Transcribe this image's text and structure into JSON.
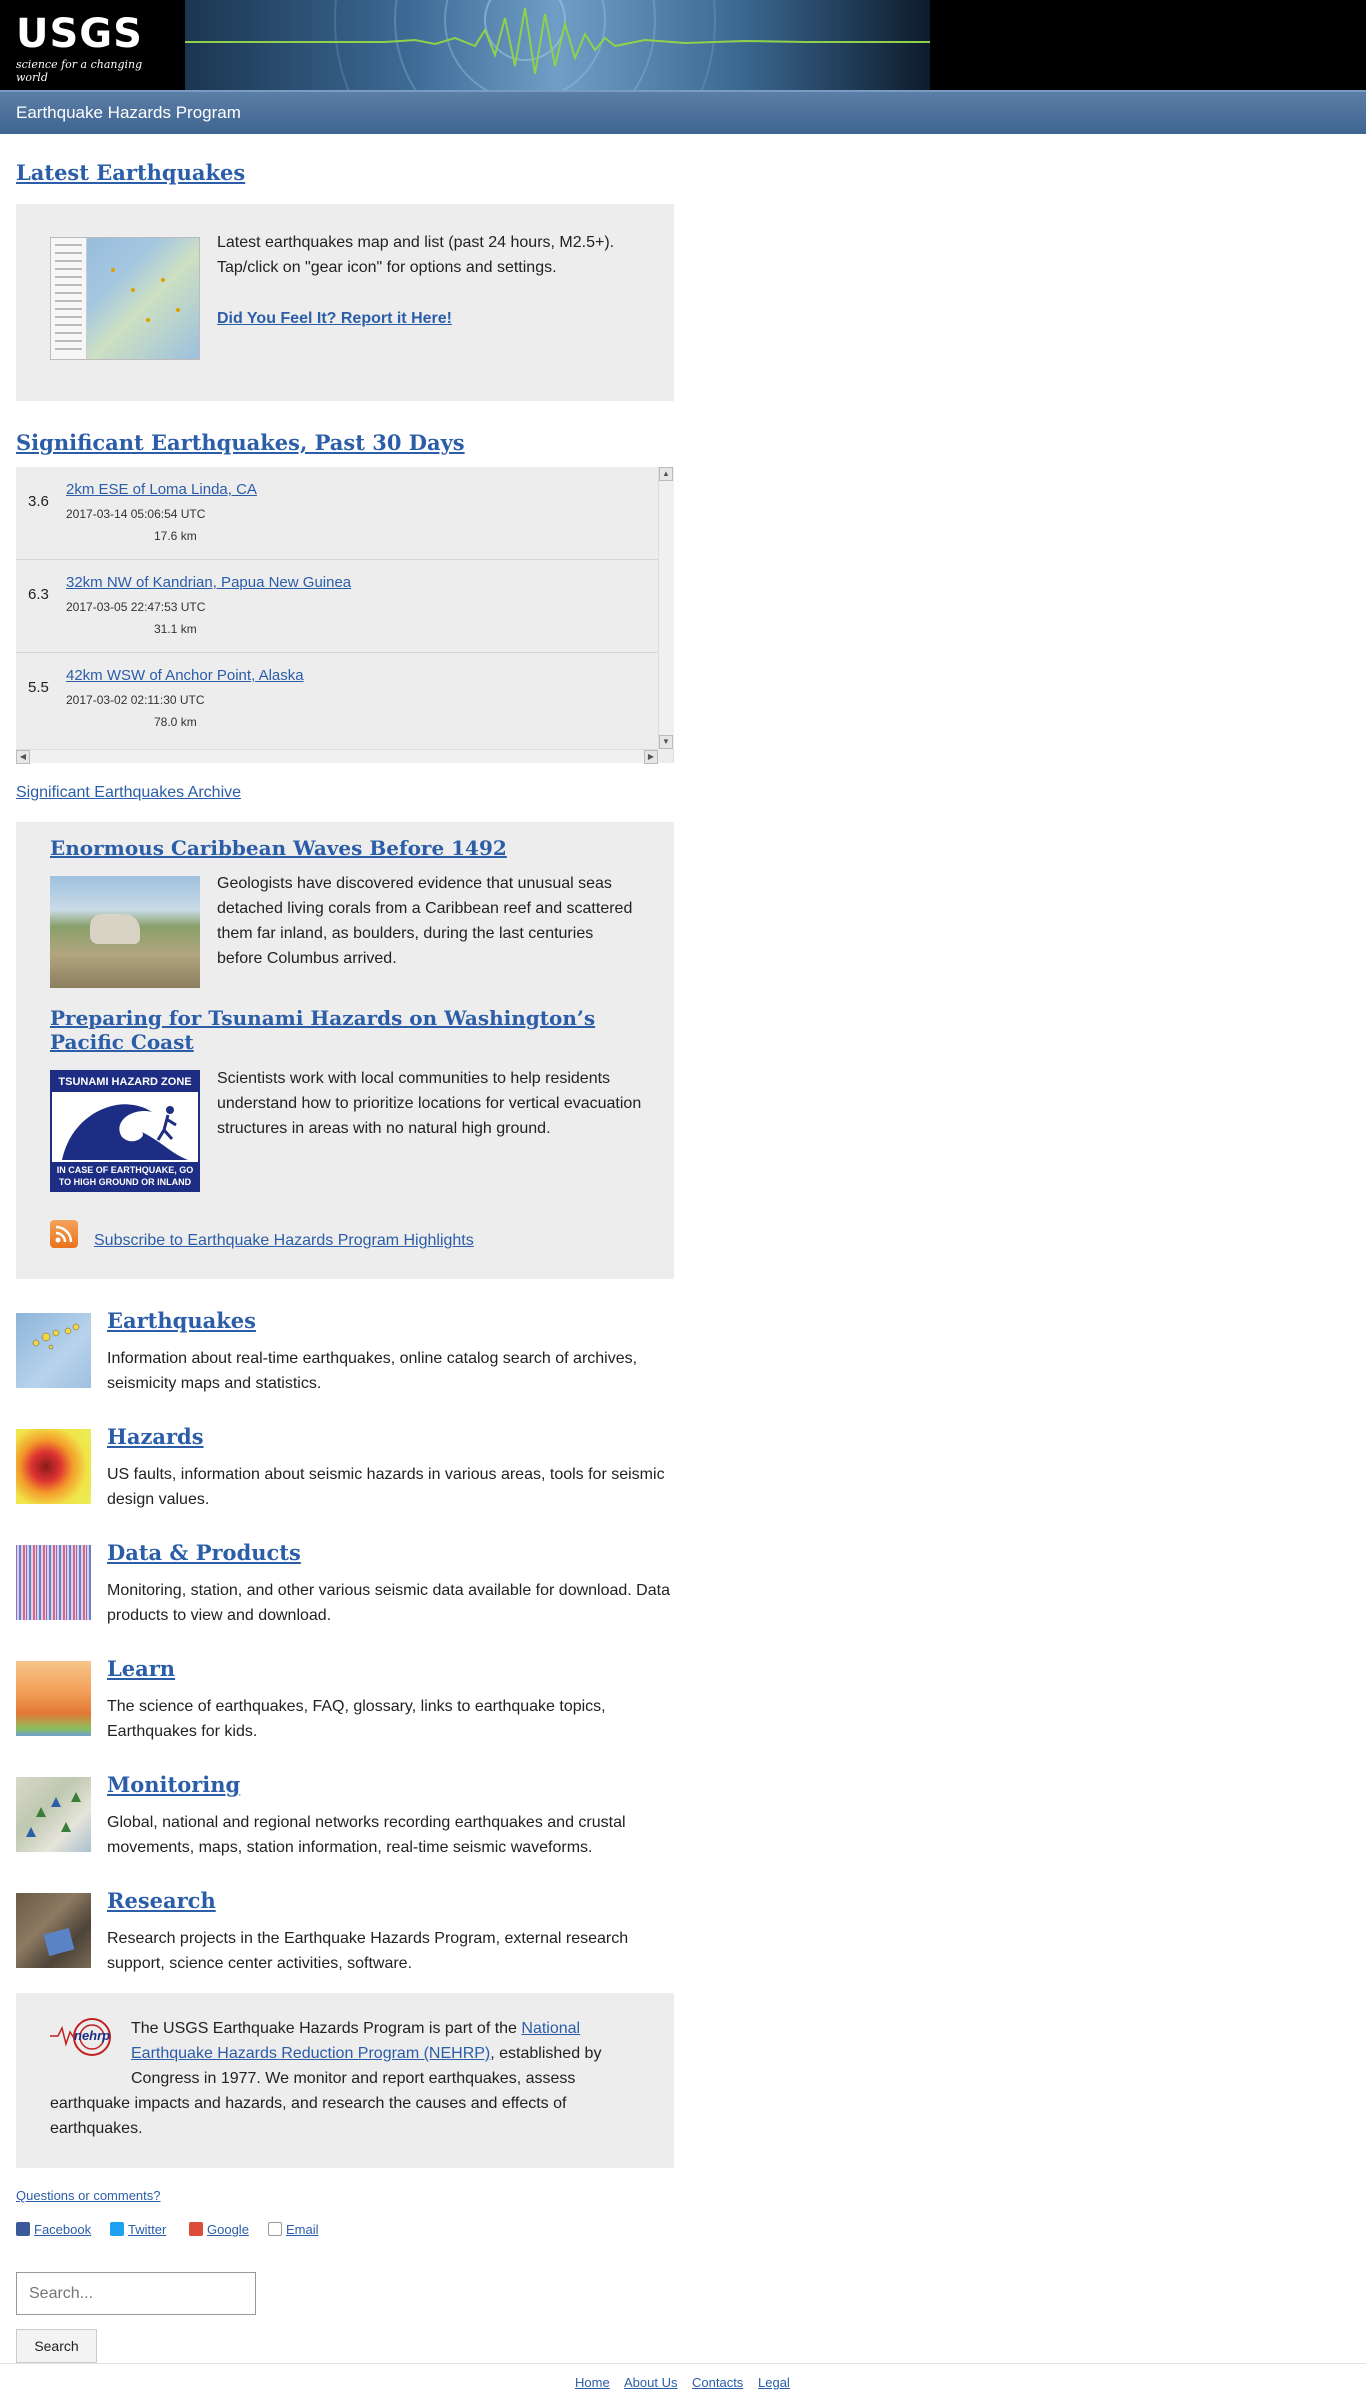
{
  "header": {
    "logo_mark": "USGS",
    "logo_tagline": "science for a changing world",
    "program_title": "Earthquake Hazards Program"
  },
  "latest": {
    "heading": "Latest Earthquakes",
    "desc": "Latest earthquakes map and list (past 24 hours, M2.5+). Tap/click on \"gear icon\" for options and settings.",
    "report_link": "Did You Feel It? Report it Here!"
  },
  "significant": {
    "heading": "Significant Earthquakes, Past 30 Days",
    "items": [
      {
        "mag": "3.6",
        "place": "2km ESE of Loma Linda, CA",
        "time": "2017-03-14 05:06:54 UTC",
        "depth": "17.6 km"
      },
      {
        "mag": "6.3",
        "place": "32km NW of Kandrian, Papua New Guinea",
        "time": "2017-03-05 22:47:53 UTC",
        "depth": "31.1 km"
      },
      {
        "mag": "5.5",
        "place": "42km WSW of Anchor Point, Alaska",
        "time": "2017-03-02 02:11:30 UTC",
        "depth": "78.0 km"
      }
    ],
    "archive_link": "Significant Earthquakes Archive"
  },
  "features": [
    {
      "title": "Enormous Caribbean Waves Before 1492",
      "text": "Geologists have discovered evidence that unusual seas detached living corals from a Caribbean reef and scattered them far inland, as boulders, during the last centuries before Columbus arrived."
    },
    {
      "title": "Preparing for Tsunami Hazards on Washington’s Pacific Coast",
      "text": "Scientists work with local communities to help residents understand how to prioritize locations for vertical evacuation structures in areas with no natural high ground.",
      "sign_top": "TSUNAMI HAZARD ZONE",
      "sign_bottom": "IN CASE OF EARTHQUAKE, GO TO HIGH GROUND OR INLAND"
    }
  ],
  "subscribe_link": "Subscribe to Earthquake Hazards Program Highlights",
  "categories": [
    {
      "title": "Earthquakes",
      "desc": "Information about real-time earthquakes, online catalog search of archives, seismicity maps and statistics."
    },
    {
      "title": "Hazards",
      "desc": "US faults, information about seismic hazards in various areas, tools for seismic design values."
    },
    {
      "title": "Data & Products",
      "desc": "Monitoring, station, and other various seismic data available for download. Data products to view and download."
    },
    {
      "title": "Learn",
      "desc": "The science of earthquakes, FAQ, glossary, links to earthquake topics, Earthquakes for kids."
    },
    {
      "title": "Monitoring",
      "desc": "Global, national and regional networks recording earthquakes and crustal movements, maps, station information, real-time seismic waveforms."
    },
    {
      "title": "Research",
      "desc": "Research projects in the Earthquake Hazards Program, external research support, science center activities, software."
    }
  ],
  "nehrp": {
    "logo_text": "nehrp",
    "text_before": "The USGS Earthquake Hazards Program is part of the ",
    "link": "National Earthquake Hazards Reduction Program (NEHRP)",
    "text_after": ", established by Congress in 1977. We monitor and report earthquakes, assess earthquake impacts and hazards, and research the causes and effects of earthquakes."
  },
  "footer": {
    "questions_link": "Questions or comments?",
    "social": [
      "Facebook",
      "Twitter",
      "Google",
      "Email"
    ],
    "search_placeholder": "Search...",
    "search_button": "Search",
    "links": [
      "Home",
      "About Us",
      "Contacts",
      "Legal"
    ]
  },
  "colors": {
    "link": "#2b5da8",
    "panel": "#ededed",
    "header_bar": "#3e6491"
  }
}
